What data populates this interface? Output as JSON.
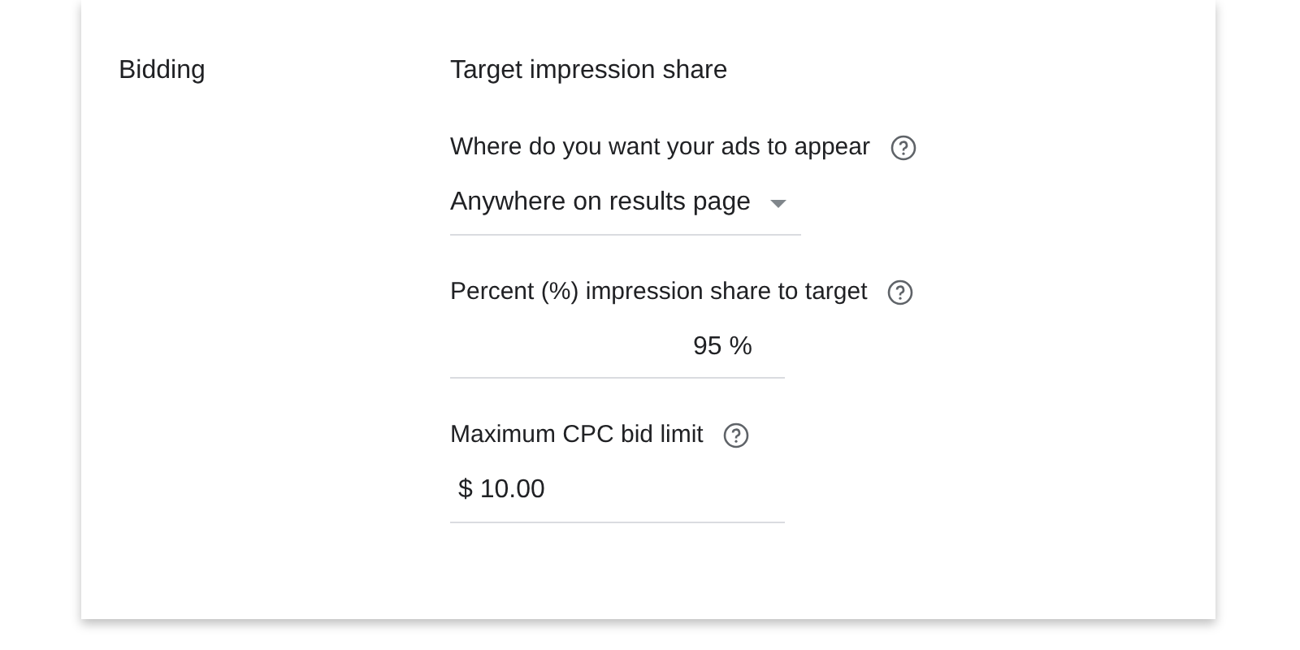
{
  "section": {
    "label": "Bidding",
    "strategy": "Target impression share",
    "fields": [
      {
        "kind": "dropdown",
        "label": "Where do you want your ads to appear",
        "value": "Anywhere on results page"
      },
      {
        "kind": "suffix",
        "label": "Percent (%) impression share to target",
        "value": "95",
        "unit": "%"
      },
      {
        "kind": "prefix",
        "label": "Maximum CPC bid limit",
        "value": "10.00",
        "unit": "$"
      }
    ]
  }
}
